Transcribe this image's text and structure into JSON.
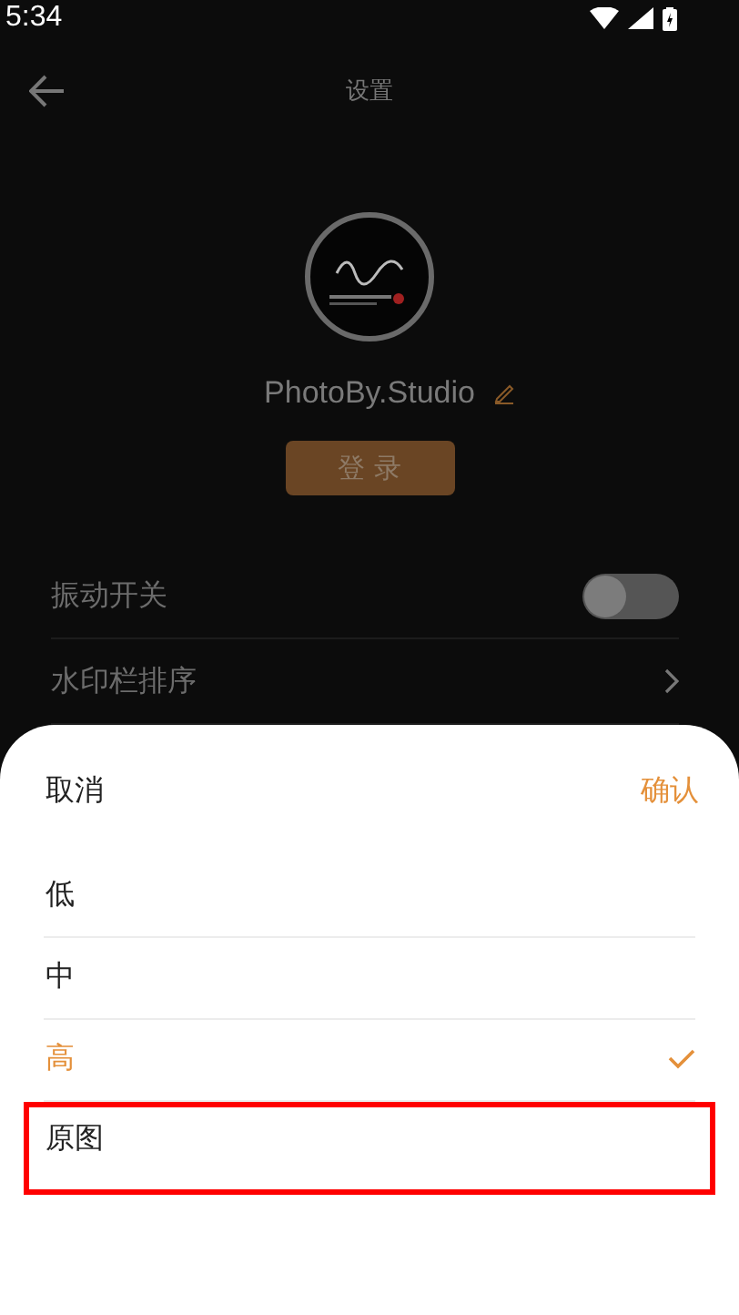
{
  "status_bar": {
    "time": "5:34"
  },
  "header": {
    "title": "设置"
  },
  "profile": {
    "name": "PhotoBy.Studio",
    "login_button": "登 录"
  },
  "settings": [
    {
      "kind": "toggle",
      "label": "振动开关",
      "on": false
    },
    {
      "kind": "link",
      "label": "水印栏排序"
    }
  ],
  "sheet": {
    "cancel": "取消",
    "confirm": "确认",
    "options": [
      {
        "label": "低",
        "selected": false,
        "highlighted": false
      },
      {
        "label": "中",
        "selected": false,
        "highlighted": false
      },
      {
        "label": "高",
        "selected": true,
        "highlighted": false
      },
      {
        "label": "原图",
        "selected": false,
        "highlighted": true
      }
    ]
  }
}
